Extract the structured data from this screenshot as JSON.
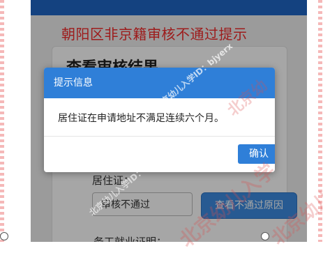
{
  "page": {
    "banner": "朝阳区非京籍审核不通过提示",
    "result_title": "查看审核结果",
    "field_label": "居住证：",
    "field_status": "审核不通过",
    "reason_button": "查看不通过原因",
    "second_label": "务工就业证明："
  },
  "dialog": {
    "title": "提示信息",
    "message": "居住证在申请地址不满足连续六个月。",
    "confirm": "确认"
  },
  "watermarks": {
    "small_1": "北京幼儿入学ID：bjyerx",
    "small_2": "北京幼儿入学ID：bjyerx",
    "big_1": "北京幼儿入学",
    "big_2": "北京幼儿",
    "big_3": "北京幼"
  },
  "colors": {
    "header_blue": "#1f66c5",
    "dialog_blue": "#2f7fd8",
    "banner_red": "#f22b2b"
  }
}
